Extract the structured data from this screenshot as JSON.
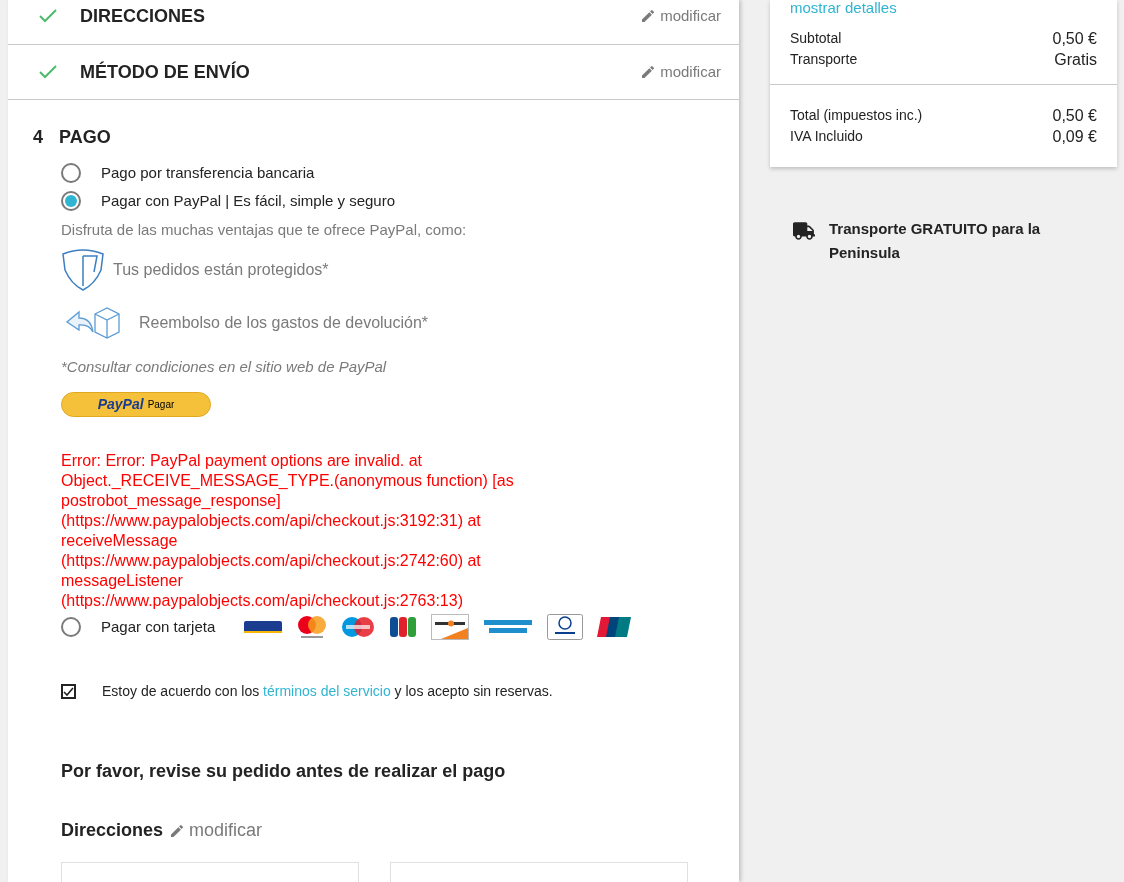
{
  "steps": [
    {
      "title": "DIRECCIONES",
      "done": true,
      "edit_label": "modificar"
    },
    {
      "title": "MÉTODO DE ENVÍO",
      "done": true,
      "edit_label": "modificar"
    }
  ],
  "payment": {
    "number": "4",
    "title": "PAGO",
    "options": [
      {
        "kind": "plain",
        "label": "Pago por transferencia bancaria",
        "selected": false
      },
      {
        "kind": "paypal",
        "label": "Pagar con PayPal | Es fácil, simple y seguro",
        "selected": true
      },
      {
        "kind": "cards",
        "label": "Pagar con tarjeta",
        "selected": false
      }
    ],
    "paypal": {
      "intro": "Disfruta de las muchas ventajas que te ofrece PayPal, como:",
      "benefits": [
        {
          "kind": "shield",
          "text": "Tus pedidos están protegidos*"
        },
        {
          "kind": "return",
          "text": "Reembolso de los gastos de devolución*"
        }
      ],
      "note": "*Consultar condiciones en el sitio web de PayPal",
      "button": {
        "brand": "PayPal",
        "label": "Pagar"
      },
      "error": "Error: Error: PayPal payment options are invalid. at Object._RECEIVE_MESSAGE_TYPE.(anonymous function) [as postrobot_message_response] (https://www.paypalobjects.com/api/checkout.js:3192:31) at receiveMessage (https://www.paypalobjects.com/api/checkout.js:2742:60) at messageListener (https://www.paypalobjects.com/api/checkout.js:2763:13)"
    },
    "terms": {
      "checked": true,
      "before": "Estoy de acuerdo con los",
      "link": "términos del servicio",
      "after": "y los acepto sin reservas."
    }
  },
  "review": {
    "heading": "Por favor, revise su pedido antes de realizar el pago",
    "addresses_title": "Direcciones",
    "edit_label": "modificar"
  },
  "summary": {
    "details_link": "mostrar detalles",
    "lines": [
      {
        "label": "Subtotal",
        "value": "0,50 €"
      },
      {
        "label": "Transporte",
        "value": "Gratis"
      }
    ],
    "totals": [
      {
        "label": "Total (impuestos inc.)",
        "value": "0,50 €"
      },
      {
        "label": "IVA Incluido",
        "value": "0,09 €"
      }
    ]
  },
  "shipping_note": "Transporte GRATUITO para la Peninsula"
}
